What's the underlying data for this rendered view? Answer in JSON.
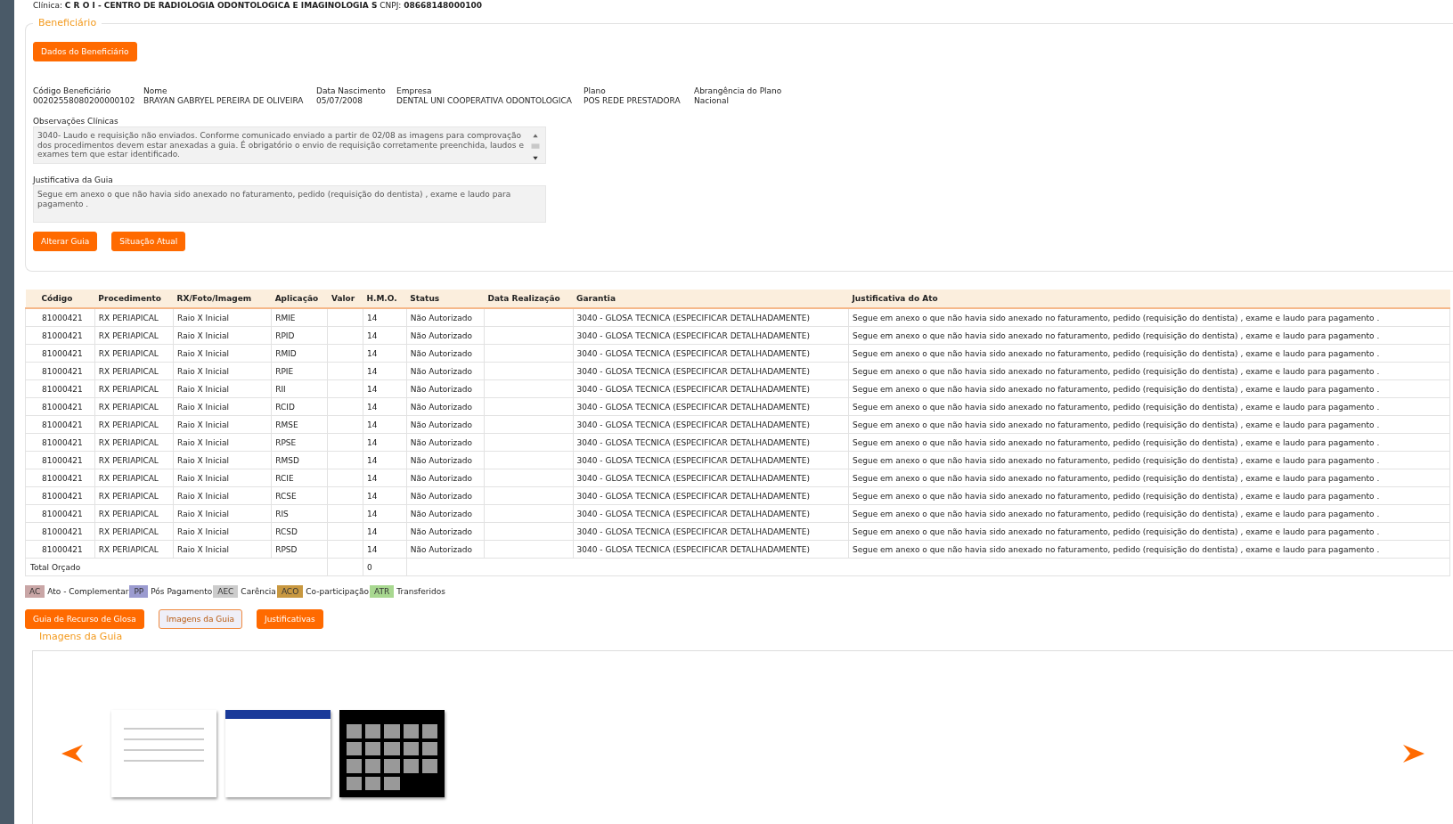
{
  "clinic_line": {
    "label": "Clínica:",
    "name": "C R O I - CENTRO DE RADIOLOGIA ODONTOLOGICA E IMAGINOLOGIA S",
    "cnpj_label": "CNPJ:",
    "cnpj": "08668148000100"
  },
  "beneficiary": {
    "legend": "Beneficiário",
    "details_button": "Dados do Beneficiário",
    "fields": [
      {
        "label": "Código Beneficiário",
        "value": "00202558080200000102"
      },
      {
        "label": "Nome",
        "value": "BRAYAN GABRYEL PEREIRA DE OLIVEIRA"
      },
      {
        "label": "Data Nascimento",
        "value": "05/07/2008"
      },
      {
        "label": "Empresa",
        "value": "DENTAL UNI COOPERATIVA ODONTOLOGICA"
      },
      {
        "label": "Plano",
        "value": "POS REDE PRESTADORA"
      },
      {
        "label": "Abrangência do Plano",
        "value": "Nacional"
      }
    ],
    "clinical_notes": {
      "label": "Observações Clínicas",
      "value": "3040- Laudo e requisição não enviados. Conforme comunicado enviado a partir de 02/08 as imagens para comprovação dos procedimentos devem estar anexadas a guia. É obrigatório o envio de requisição corretamente preenchida, laudos e exames tem que estar identificado."
    },
    "justification": {
      "label": "Justificativa da Guia",
      "value": "Segue em anexo o que não havia sido anexado no faturamento, pedido (requisição do dentista) , exame e laudo para pagamento ."
    },
    "buttons": [
      "Alterar Guia",
      "Situação Atual"
    ]
  },
  "table": {
    "columns": [
      "Código",
      "Procedimento",
      "RX/Foto/Imagem",
      "Aplicação",
      "Valor",
      "H.M.O.",
      "Status",
      "Data Realização",
      "Garantia",
      "Justificativa do Ato"
    ],
    "rows": [
      [
        "81000421",
        "RX PERIAPICAL",
        "Raio X Inicial",
        "RMIE",
        "",
        "14",
        "Não Autorizado",
        "",
        "3040 - GLOSA TECNICA (ESPECIFICAR DETALHADAMENTE)",
        "Segue em anexo o que não havia sido anexado no faturamento, pedido (requisição do dentista) , exame e laudo para pagamento ."
      ],
      [
        "81000421",
        "RX PERIAPICAL",
        "Raio X Inicial",
        "RPID",
        "",
        "14",
        "Não Autorizado",
        "",
        "3040 - GLOSA TECNICA (ESPECIFICAR DETALHADAMENTE)",
        "Segue em anexo o que não havia sido anexado no faturamento, pedido (requisição do dentista) , exame e laudo para pagamento ."
      ],
      [
        "81000421",
        "RX PERIAPICAL",
        "Raio X Inicial",
        "RMID",
        "",
        "14",
        "Não Autorizado",
        "",
        "3040 - GLOSA TECNICA (ESPECIFICAR DETALHADAMENTE)",
        "Segue em anexo o que não havia sido anexado no faturamento, pedido (requisição do dentista) , exame e laudo para pagamento ."
      ],
      [
        "81000421",
        "RX PERIAPICAL",
        "Raio X Inicial",
        "RPIE",
        "",
        "14",
        "Não Autorizado",
        "",
        "3040 - GLOSA TECNICA (ESPECIFICAR DETALHADAMENTE)",
        "Segue em anexo o que não havia sido anexado no faturamento, pedido (requisição do dentista) , exame e laudo para pagamento ."
      ],
      [
        "81000421",
        "RX PERIAPICAL",
        "Raio X Inicial",
        "RII",
        "",
        "14",
        "Não Autorizado",
        "",
        "3040 - GLOSA TECNICA (ESPECIFICAR DETALHADAMENTE)",
        "Segue em anexo o que não havia sido anexado no faturamento, pedido (requisição do dentista) , exame e laudo para pagamento ."
      ],
      [
        "81000421",
        "RX PERIAPICAL",
        "Raio X Inicial",
        "RCID",
        "",
        "14",
        "Não Autorizado",
        "",
        "3040 - GLOSA TECNICA (ESPECIFICAR DETALHADAMENTE)",
        "Segue em anexo o que não havia sido anexado no faturamento, pedido (requisição do dentista) , exame e laudo para pagamento ."
      ],
      [
        "81000421",
        "RX PERIAPICAL",
        "Raio X Inicial",
        "RMSE",
        "",
        "14",
        "Não Autorizado",
        "",
        "3040 - GLOSA TECNICA (ESPECIFICAR DETALHADAMENTE)",
        "Segue em anexo o que não havia sido anexado no faturamento, pedido (requisição do dentista) , exame e laudo para pagamento ."
      ],
      [
        "81000421",
        "RX PERIAPICAL",
        "Raio X Inicial",
        "RPSE",
        "",
        "14",
        "Não Autorizado",
        "",
        "3040 - GLOSA TECNICA (ESPECIFICAR DETALHADAMENTE)",
        "Segue em anexo o que não havia sido anexado no faturamento, pedido (requisição do dentista) , exame e laudo para pagamento ."
      ],
      [
        "81000421",
        "RX PERIAPICAL",
        "Raio X Inicial",
        "RMSD",
        "",
        "14",
        "Não Autorizado",
        "",
        "3040 - GLOSA TECNICA (ESPECIFICAR DETALHADAMENTE)",
        "Segue em anexo o que não havia sido anexado no faturamento, pedido (requisição do dentista) , exame e laudo para pagamento ."
      ],
      [
        "81000421",
        "RX PERIAPICAL",
        "Raio X Inicial",
        "RCIE",
        "",
        "14",
        "Não Autorizado",
        "",
        "3040 - GLOSA TECNICA (ESPECIFICAR DETALHADAMENTE)",
        "Segue em anexo o que não havia sido anexado no faturamento, pedido (requisição do dentista) , exame e laudo para pagamento ."
      ],
      [
        "81000421",
        "RX PERIAPICAL",
        "Raio X Inicial",
        "RCSE",
        "",
        "14",
        "Não Autorizado",
        "",
        "3040 - GLOSA TECNICA (ESPECIFICAR DETALHADAMENTE)",
        "Segue em anexo o que não havia sido anexado no faturamento, pedido (requisição do dentista) , exame e laudo para pagamento ."
      ],
      [
        "81000421",
        "RX PERIAPICAL",
        "Raio X Inicial",
        "RIS",
        "",
        "14",
        "Não Autorizado",
        "",
        "3040 - GLOSA TECNICA (ESPECIFICAR DETALHADAMENTE)",
        "Segue em anexo o que não havia sido anexado no faturamento, pedido (requisição do dentista) , exame e laudo para pagamento ."
      ],
      [
        "81000421",
        "RX PERIAPICAL",
        "Raio X Inicial",
        "RCSD",
        "",
        "14",
        "Não Autorizado",
        "",
        "3040 - GLOSA TECNICA (ESPECIFICAR DETALHADAMENTE)",
        "Segue em anexo o que não havia sido anexado no faturamento, pedido (requisição do dentista) , exame e laudo para pagamento ."
      ],
      [
        "81000421",
        "RX PERIAPICAL",
        "Raio X Inicial",
        "RPSD",
        "",
        "14",
        "Não Autorizado",
        "",
        "3040 - GLOSA TECNICA (ESPECIFICAR DETALHADAMENTE)",
        "Segue em anexo o que não havia sido anexado no faturamento, pedido (requisição do dentista) , exame e laudo para pagamento ."
      ]
    ],
    "total": {
      "label": "Total Orçado",
      "hmo": "0"
    }
  },
  "legend": [
    {
      "code": "AC",
      "label": "Ato - Complementar",
      "color": "#c9a6a6"
    },
    {
      "code": "PP",
      "label": "Pós Pagamento",
      "color": "#9b9bd0"
    },
    {
      "code": "AEC",
      "label": "Carência",
      "color": "#cccccc"
    },
    {
      "code": "ACO",
      "label": "Co-participação",
      "color": "#c89840"
    },
    {
      "code": "ATR",
      "label": "Transferidos",
      "color": "#a8d890"
    }
  ],
  "action_buttons": [
    {
      "label": "Guia de Recurso de Glosa",
      "selected": false
    },
    {
      "label": "Imagens da Guia",
      "selected": true
    },
    {
      "label": "Justificativas",
      "selected": false
    }
  ],
  "images": {
    "legend": "Imagens da Guia",
    "thumbnails": [
      {
        "kind": "document"
      },
      {
        "kind": "form"
      },
      {
        "kind": "xray"
      }
    ]
  }
}
